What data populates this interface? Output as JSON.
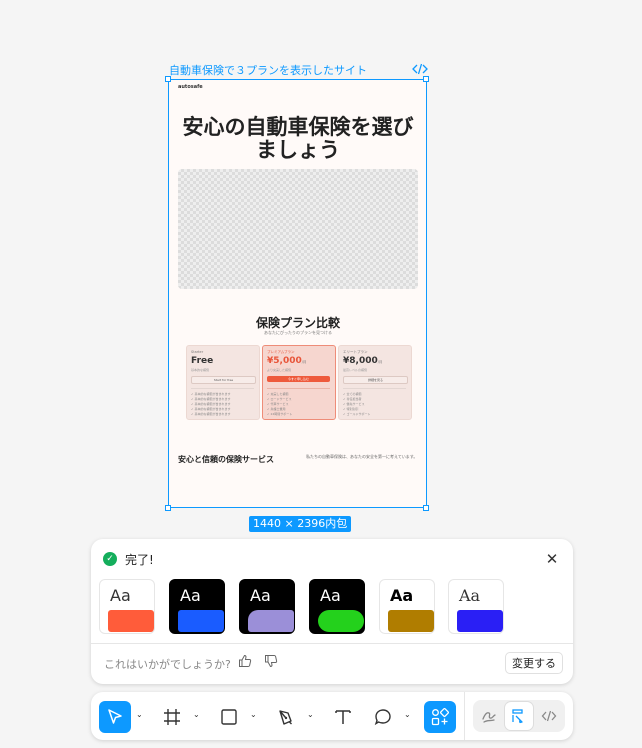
{
  "frame": {
    "label": "自動車保険で３プランを表示したサイト",
    "size_badge": "1440 × 2396内包"
  },
  "site": {
    "logo": "autosafe",
    "hero_title": "安心の自動車保険を選びましょう",
    "compare_title": "保険プラン比較",
    "compare_subtitle": "あなたにぴったりのプランを見つける",
    "plans": [
      {
        "name": "Starter",
        "price": "Free",
        "unit": "",
        "desc": "基本的な補償",
        "button": "Start for free",
        "features": [
          "基本的な補償が含まれます",
          "基本的な補償が含まれます",
          "基本的な補償が含まれます",
          "基本的な補償が含まれます",
          "基本的な補償が含まれます"
        ]
      },
      {
        "name": "プレミアムプラン",
        "price": "¥5,000",
        "unit": "/月",
        "desc": "より充実した補償",
        "button": "今すぐ申し込む",
        "features": [
          "充実した補償",
          "ロードサービス",
          "代車サービス",
          "弁護士費用",
          "24時間サポート"
        ]
      },
      {
        "name": "エリートプラン",
        "price": "¥8,000",
        "unit": "/月",
        "desc": "最高レベルの補償",
        "button": "詳細を見る",
        "features": [
          "全ての補償",
          "専任担当者",
          "優先サービス",
          "特別割引",
          "ゴールドサポート"
        ]
      }
    ],
    "footer_title": "安心と信頼の保険サービス",
    "footer_text": "私たちの自動車保険は、あなたの安全を第一に考えています。"
  },
  "result_panel": {
    "status": "完了!",
    "themes": [
      {
        "label": "Aa",
        "bg": "#ffffff",
        "fg": "#333333",
        "accent": "#ff5c3a",
        "border": "#e6e6e6"
      },
      {
        "label": "Aa",
        "bg": "#000000",
        "fg": "#ffffff",
        "accent": "#1a5cff",
        "border": "#000000"
      },
      {
        "label": "Aa",
        "bg": "#000000",
        "fg": "#ffffff",
        "accent": "#9b8fd8",
        "border": "#000000"
      },
      {
        "label": "Aa",
        "bg": "#000000",
        "fg": "#ffffff",
        "accent": "#24d11c",
        "border": "#000000"
      },
      {
        "label": "Aa",
        "bg": "#ffffff",
        "fg": "#000000",
        "accent": "#b07d00",
        "border": "#e6e6e6"
      },
      {
        "label": "Aa",
        "bg": "#ffffff",
        "fg": "#333333",
        "accent": "#2a1ff5",
        "border": "#e6e6e6"
      }
    ],
    "feedback_prompt": "これはいかがでしょうか?",
    "change_button": "変更する"
  },
  "toolbar": {
    "tools": [
      "move-tool",
      "frame-tool",
      "rectangle-tool",
      "pen-tool",
      "text-tool",
      "comment-tool",
      "actions-tool"
    ],
    "active_tool": "move-tool",
    "modes": [
      "draw-mode",
      "design-mode",
      "dev-mode"
    ],
    "active_mode": "design-mode",
    "accent": "#0d99ff"
  }
}
